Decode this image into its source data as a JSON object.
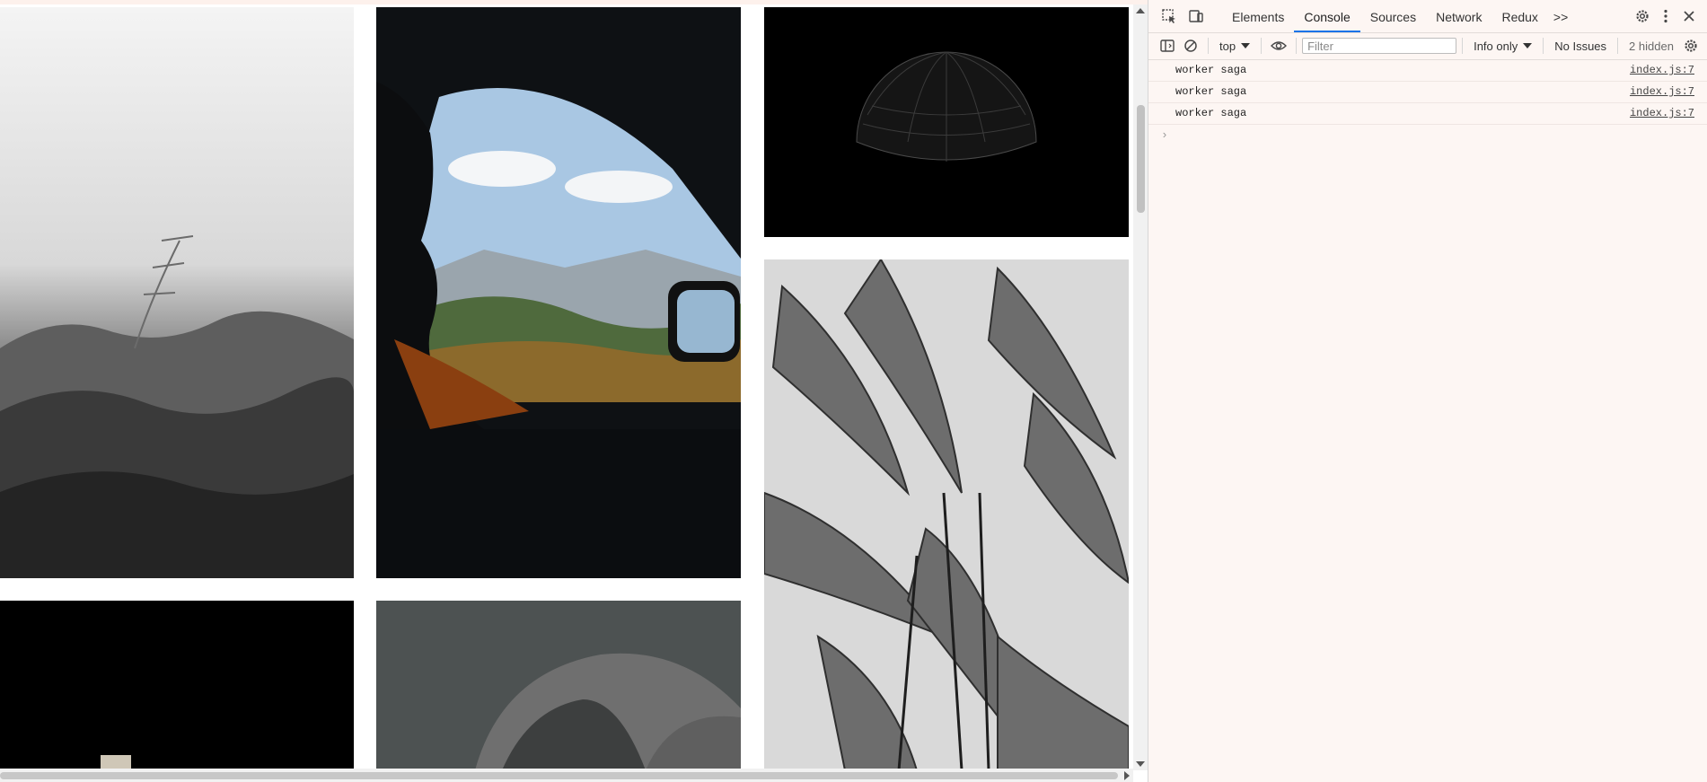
{
  "devtools": {
    "tabs": [
      "Elements",
      "Console",
      "Sources",
      "Network",
      "Redux"
    ],
    "active_tab": "Console",
    "more_tabs_label": ">>",
    "toolbar": {
      "context": "top",
      "filter_placeholder": "Filter",
      "level": "Info only",
      "issues": "No Issues",
      "hidden": "2 hidden"
    },
    "messages": [
      {
        "text": "worker saga",
        "source": "index.js:7"
      },
      {
        "text": "worker saga",
        "source": "index.js:7"
      },
      {
        "text": "worker saga",
        "source": "index.js:7"
      }
    ],
    "prompt": "›",
    "icons": [
      "inspect-icon",
      "device-toolbar-icon",
      "settings-icon",
      "kebab-menu-icon",
      "close-icon",
      "sidebar-icon",
      "clear-console-icon",
      "eye-icon",
      "console-settings-icon"
    ]
  },
  "gallery": {
    "images": [
      "grass-photo",
      "car-window-photo",
      "wireframe-dome-photo",
      "palm-leaves-photo",
      "dark-photo",
      "gray-abstract-photo"
    ]
  }
}
